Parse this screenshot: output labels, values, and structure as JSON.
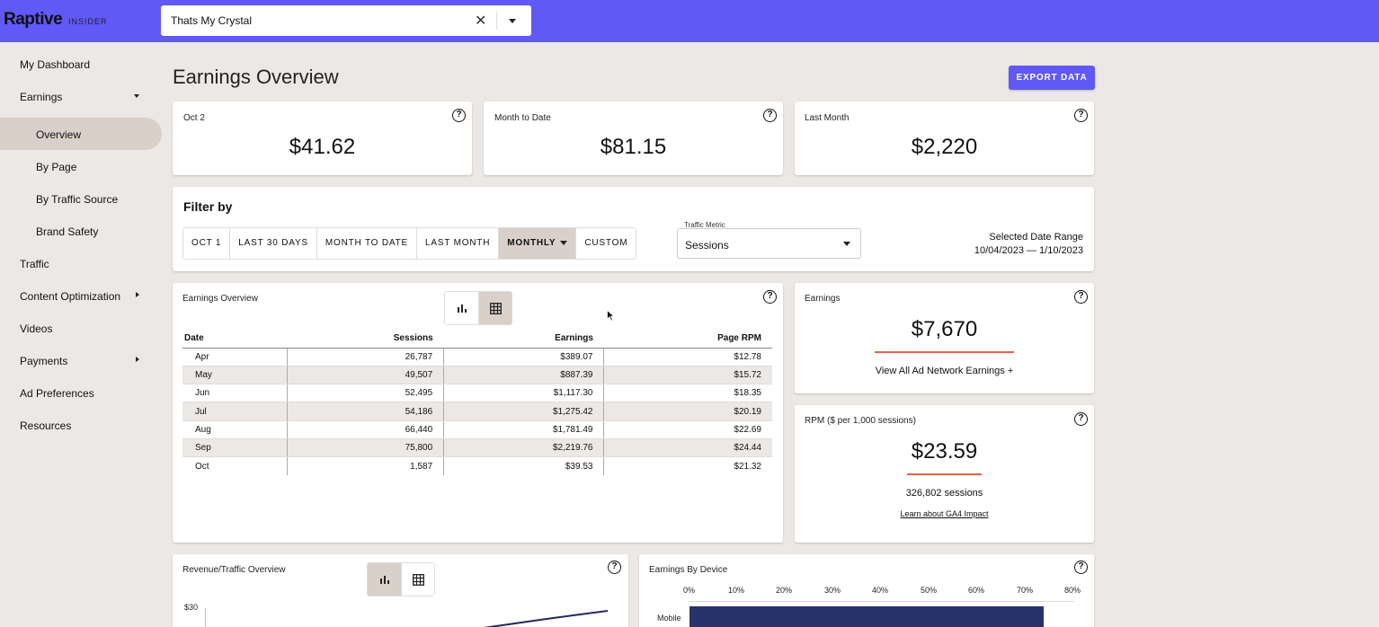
{
  "header": {
    "logo": "Raptive",
    "logo_sub": "INSIDER",
    "site_select_value": "Thats My Crystal"
  },
  "sidebar": {
    "items": [
      {
        "label": "My Dashboard"
      },
      {
        "label": "Earnings"
      },
      {
        "label": "Overview"
      },
      {
        "label": "By Page"
      },
      {
        "label": "By Traffic Source"
      },
      {
        "label": "Brand Safety"
      },
      {
        "label": "Traffic"
      },
      {
        "label": "Content Optimization"
      },
      {
        "label": "Videos"
      },
      {
        "label": "Payments"
      },
      {
        "label": "Ad Preferences"
      },
      {
        "label": "Resources"
      }
    ]
  },
  "main": {
    "title": "Earnings Overview",
    "export_label": "EXPORT DATA",
    "summary": [
      {
        "label": "Oct 2",
        "value": "$41.62"
      },
      {
        "label": "Month to Date",
        "value": "$81.15"
      },
      {
        "label": "Last Month",
        "value": "$2,220"
      }
    ],
    "filter": {
      "title": "Filter by",
      "buttons": [
        "OCT 1",
        "LAST 30 DAYS",
        "MONTH TO DATE",
        "LAST MONTH",
        "MONTHLY",
        "CUSTOM"
      ],
      "active": "MONTHLY",
      "metric_label": "Traffic Metric",
      "metric_value": "Sessions",
      "date_range_label": "Selected Date Range",
      "date_range_value": "10/04/2023 — 1/10/2023"
    },
    "overview_table": {
      "title": "Earnings Overview",
      "headers": [
        "Date",
        "Sessions",
        "Earnings",
        "Page RPM"
      ],
      "rows": [
        [
          "Apr",
          "26,787",
          "$389.07",
          "$12.78"
        ],
        [
          "May",
          "49,507",
          "$887.39",
          "$15.72"
        ],
        [
          "Jun",
          "52,495",
          "$1,117.30",
          "$18.35"
        ],
        [
          "Jul",
          "54,186",
          "$1,275.42",
          "$20.19"
        ],
        [
          "Aug",
          "66,440",
          "$1,781.49",
          "$22.69"
        ],
        [
          "Sep",
          "75,800",
          "$2,219.76",
          "$24.44"
        ],
        [
          "Oct",
          "1,587",
          "$39.53",
          "$21.32"
        ]
      ]
    },
    "earnings_card": {
      "label": "Earnings",
      "value": "$7,670",
      "link": "View All Ad Network Earnings +"
    },
    "rpm_card": {
      "label": "RPM ($ per 1,000 sessions)",
      "value": "$23.59",
      "sessions": "326,802 sessions",
      "link": "Learn about GA4 Impact"
    },
    "revenue_traffic": {
      "title": "Revenue/Traffic Overview",
      "y_tick": "$30"
    },
    "earnings_by_device": {
      "title": "Earnings By Device",
      "ticks": [
        "0%",
        "10%",
        "20%",
        "30%",
        "40%",
        "50%",
        "60%",
        "70%",
        "80%"
      ],
      "bars": [
        {
          "label": "Mobile",
          "value": 74
        }
      ]
    }
  },
  "colors": {
    "accent": "#6159f5",
    "background": "#ece8e6",
    "active_nav": "#d9d0ca",
    "underline": "#e8624a",
    "bar": "#283469"
  }
}
